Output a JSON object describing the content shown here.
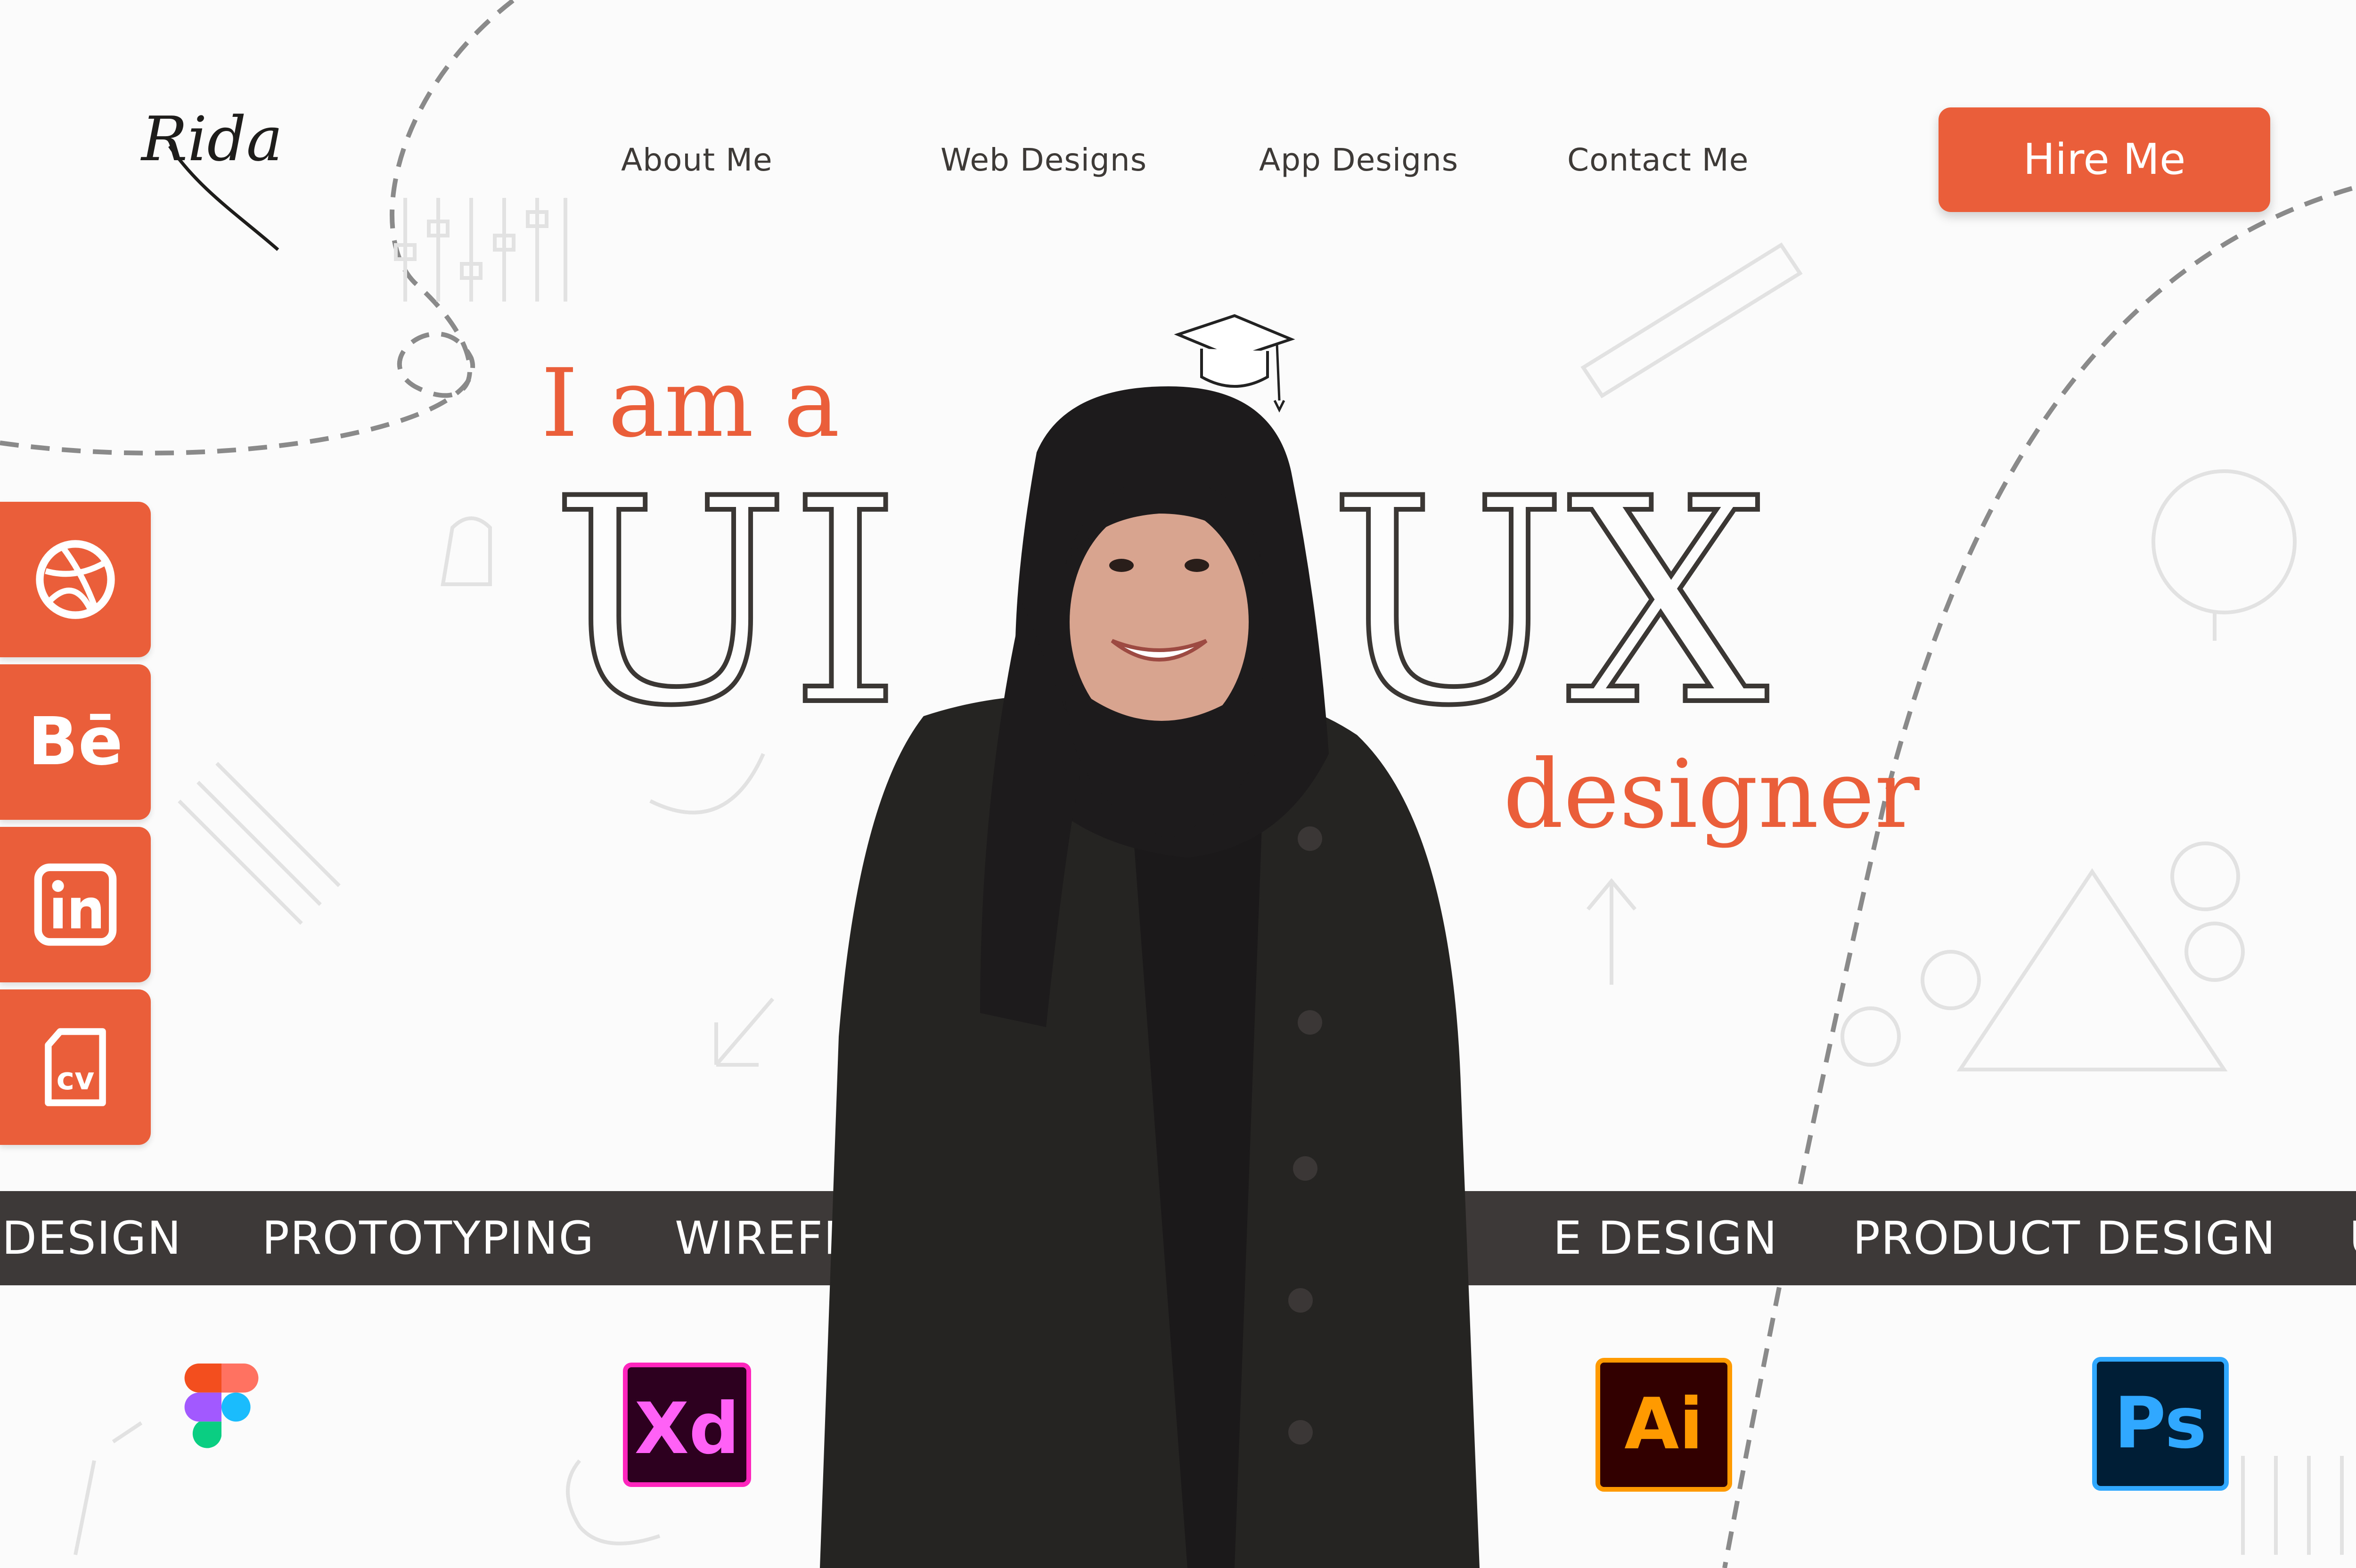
{
  "brand": {
    "logo_text": "Rida"
  },
  "nav": {
    "items": [
      "About Me",
      "Web Designs",
      "App Designs",
      "Contact Me"
    ],
    "cta": "Hire Me"
  },
  "hero": {
    "line1": "I am a",
    "big_left": "UI",
    "big_right": "UX",
    "line3": "designer"
  },
  "social": [
    {
      "icon": "dribbble-icon"
    },
    {
      "icon": "behance-icon",
      "text": "Bē"
    },
    {
      "icon": "linkedin-icon"
    },
    {
      "icon": "cv-icon"
    }
  ],
  "skills_band": [
    "DESIGN",
    "PROTOTYPING",
    "WIREFR",
    "E DESIGN",
    "PRODUCT DESIGN",
    "USI"
  ],
  "tools": [
    {
      "icon": "figma-icon"
    },
    {
      "icon": "adobe-xd-icon",
      "text": "Xd"
    },
    {
      "icon": "adobe-illustrator-icon",
      "text": "Ai"
    },
    {
      "icon": "adobe-photoshop-icon",
      "text": "Ps"
    }
  ],
  "colors": {
    "accent": "#ea5f3a",
    "dark": "#3d3938",
    "background": "#fbfbfb"
  }
}
